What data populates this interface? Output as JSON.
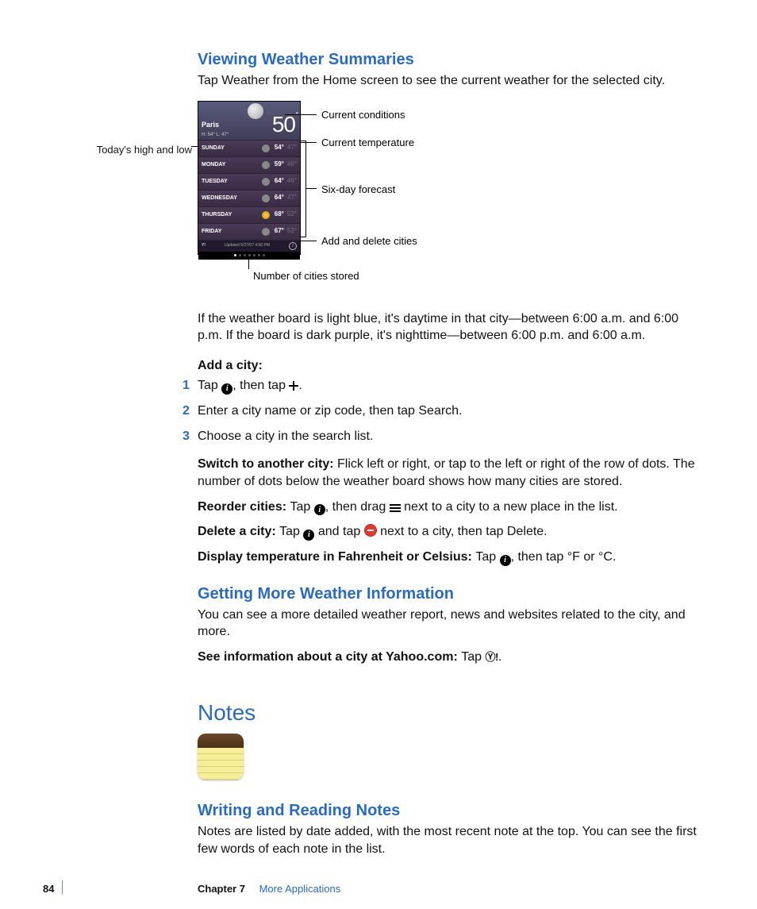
{
  "section1": {
    "title": "Viewing Weather Summaries",
    "intro": "Tap Weather from the Home screen to see the current weather for the selected city."
  },
  "weather_widget": {
    "city": "Paris",
    "hl": "H: 54° L: 47°",
    "temp": "50",
    "forecast": [
      {
        "day": "SUNDAY",
        "hi": "54°",
        "lo": "47°",
        "sun": false
      },
      {
        "day": "MONDAY",
        "hi": "59°",
        "lo": "46°",
        "sun": false
      },
      {
        "day": "TUESDAY",
        "hi": "64°",
        "lo": "46°",
        "sun": false
      },
      {
        "day": "WEDNESDAY",
        "hi": "64°",
        "lo": "47°",
        "sun": false
      },
      {
        "day": "THURSDAY",
        "hi": "68°",
        "lo": "52°",
        "sun": true
      },
      {
        "day": "FRIDAY",
        "hi": "67°",
        "lo": "52°",
        "sun": false
      }
    ],
    "updated": "Updated 5/27/07 4:50 PM"
  },
  "callouts": {
    "left": "Today's high and low",
    "conditions": "Current conditions",
    "temperature": "Current temperature",
    "forecast": "Six-day forecast",
    "add_delete": "Add and delete cities",
    "dots": "Number of cities stored"
  },
  "para_daynight": "If the weather board is light blue, it's daytime in that city—between 6:00 a.m. and 6:00 p.m. If the board is dark purple, it's nighttime—between 6:00 p.m. and 6:00 a.m.",
  "add_city": {
    "heading": "Add a city:",
    "step1a": "Tap ",
    "step1b": ", then tap ",
    "step1c": ".",
    "step2": "Enter a city name or zip code, then tap Search.",
    "step3": "Choose a city in the search list."
  },
  "switch": {
    "label": "Switch to another city:  ",
    "text": "Flick left or right, or tap to the left or right of the row of dots. The number of dots below the weather board shows how many cities are stored."
  },
  "reorder": {
    "label": "Reorder cities:  ",
    "a": "Tap ",
    "b": ", then drag ",
    "c": " next to a city to a new place in the list."
  },
  "delete": {
    "label": "Delete a city:  ",
    "a": "Tap ",
    "b": " and tap ",
    "c": " next to a city, then tap Delete."
  },
  "units": {
    "label": "Display temperature in Fahrenheit or Celsius:  ",
    "a": "Tap ",
    "b": ", then tap °F or °C."
  },
  "section2": {
    "title": "Getting More Weather Information",
    "body": "You can see a more detailed weather report, news and websites related to the city, and more.",
    "yahoo_label": "See information about a city at Yahoo.com:  ",
    "yahoo_a": "Tap ",
    "yahoo_b": "."
  },
  "notes": {
    "title": "Notes"
  },
  "section3": {
    "title": "Writing and Reading Notes",
    "body": "Notes are listed by date added, with the most recent note at the top. You can see the first few words of each note in the list."
  },
  "footer": {
    "page": "84",
    "chapter_label": "Chapter 7",
    "chapter_title": "More Applications"
  }
}
